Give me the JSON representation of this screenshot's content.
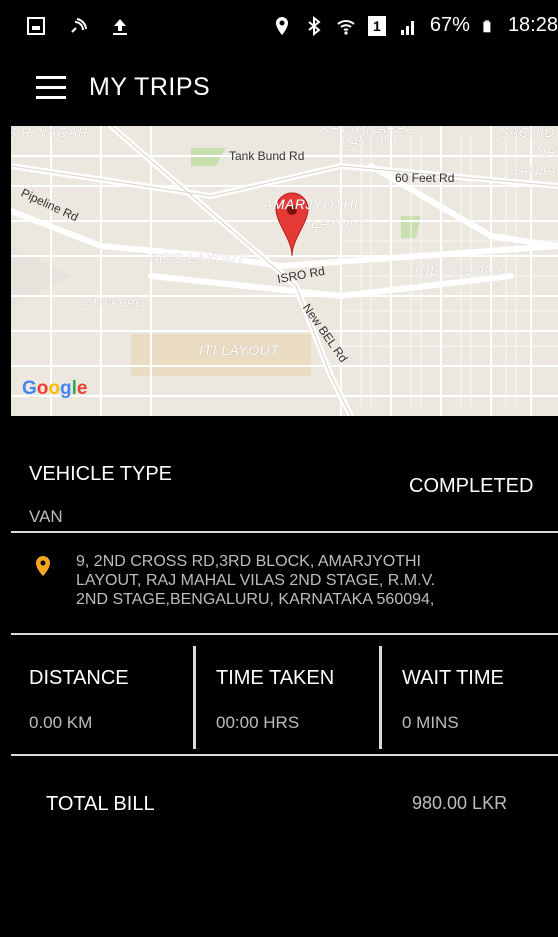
{
  "status_bar": {
    "battery": "67%",
    "time": "18:28",
    "sim": "1"
  },
  "header": {
    "title": "MY TRIPS"
  },
  "map": {
    "roads": [
      "Tank Bund Rd",
      "60 Feet Rd",
      "Pipeline Rd",
      "ISRO Rd",
      "New BEL Rd"
    ],
    "areas": [
      "S R NAGAR",
      "KRISHNAPPA",
      "LAYOUT",
      "SACHID",
      "NA",
      "SANJA",
      "AMARJYOTHI",
      "LAYOUT",
      "AG'S LAYOUT",
      "CIL COLONY",
      "MATHIKERE",
      "ITI LAYOUT"
    ],
    "provider": "Google",
    "colors": {
      "pin": "#e53935",
      "base": "#ece8e0",
      "road": "#ffffff",
      "park": "#c9dfb0"
    }
  },
  "trip": {
    "vehicle_type_label": "VEHICLE TYPE",
    "vehicle_type_value": "VAN",
    "status": "COMPLETED",
    "address_lines": [
      "9, 2ND CROSS RD,3RD BLOCK, AMARJYOTHI",
      "LAYOUT, RAJ MAHAL VILAS 2ND STAGE, R.M.V.",
      "2ND STAGE,BENGALURU, KARNATAKA 560094,"
    ],
    "stats": [
      {
        "label": "DISTANCE",
        "value": "0.00 KM"
      },
      {
        "label": "TIME TAKEN",
        "value": "00:00 HRS"
      },
      {
        "label": "WAIT TIME",
        "value": "0 MINS"
      }
    ],
    "total_label": "TOTAL BILL",
    "total_value": "980.00 LKR"
  },
  "colors": {
    "background": "#000000",
    "text": "#ffffff",
    "muted_text": "#bdbdbd",
    "divider": "#d9d9d9",
    "pin_accent": "#f5a623"
  }
}
